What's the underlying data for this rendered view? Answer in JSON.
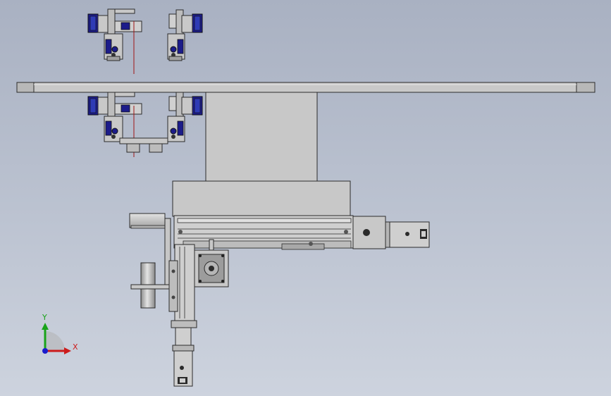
{
  "viewport": {
    "background_top": "#a9b1c2",
    "background_bottom": "#cdd3de",
    "part_fill": "#c8c8c8",
    "part_dark": "#9a9a9a",
    "edge_color": "#2b2b2b",
    "motor_blue": "#1c1c8a"
  },
  "triad": {
    "x_label": "X",
    "y_label": "Y",
    "x_color": "#cc1b1b",
    "y_color": "#19a319",
    "z_color": "#1b1bcc"
  }
}
